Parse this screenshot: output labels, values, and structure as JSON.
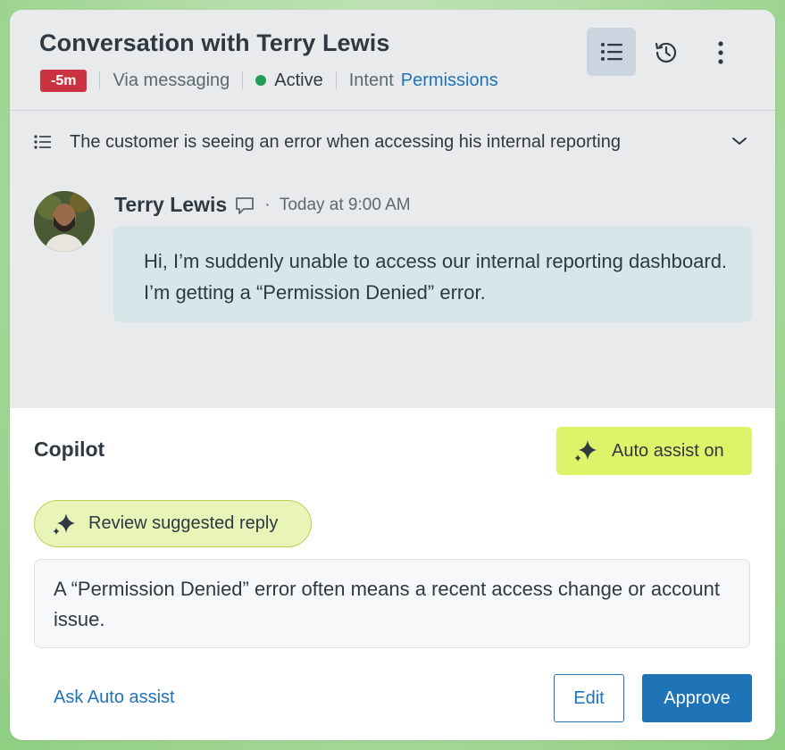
{
  "header": {
    "title": "Conversation with Terry Lewis",
    "sla_badge": "-5m",
    "channel": "Via messaging",
    "status": "Active",
    "intent_label": "Intent",
    "intent_value": "Permissions",
    "icons": [
      "list-icon",
      "history-icon",
      "more-vertical-icon"
    ]
  },
  "summary": {
    "text": "The customer is seeing an error when accessing his internal reporting",
    "icons": [
      "list-icon",
      "chevron-down-icon"
    ]
  },
  "message": {
    "author": "Terry Lewis",
    "separator": "·",
    "time": "Today at 9:00 AM",
    "body": "Hi, I’m suddenly unable to access our internal reporting dashboard. I’m getting a “Permission Denied” error.",
    "icons": [
      "avatar",
      "chat-bubble-icon"
    ]
  },
  "copilot": {
    "title": "Copilot",
    "auto_assist_label": "Auto assist on",
    "review_label": "Review suggested reply",
    "suggested_reply": "A “Permission Denied” error often means a recent access change or account issue.",
    "ask_link": "Ask Auto assist",
    "edit_label": "Edit",
    "approve_label": "Approve",
    "icons": [
      "sparkle-icon"
    ]
  },
  "colors": {
    "badge": "#cc3340",
    "active_dot": "#1f9d55",
    "link": "#1f73b7",
    "auto_assist_bg": "#dff36a",
    "review_bg": "#e8f4b8",
    "approve_bg": "#1f73b7",
    "bubble_bg": "#d6e6e9"
  }
}
